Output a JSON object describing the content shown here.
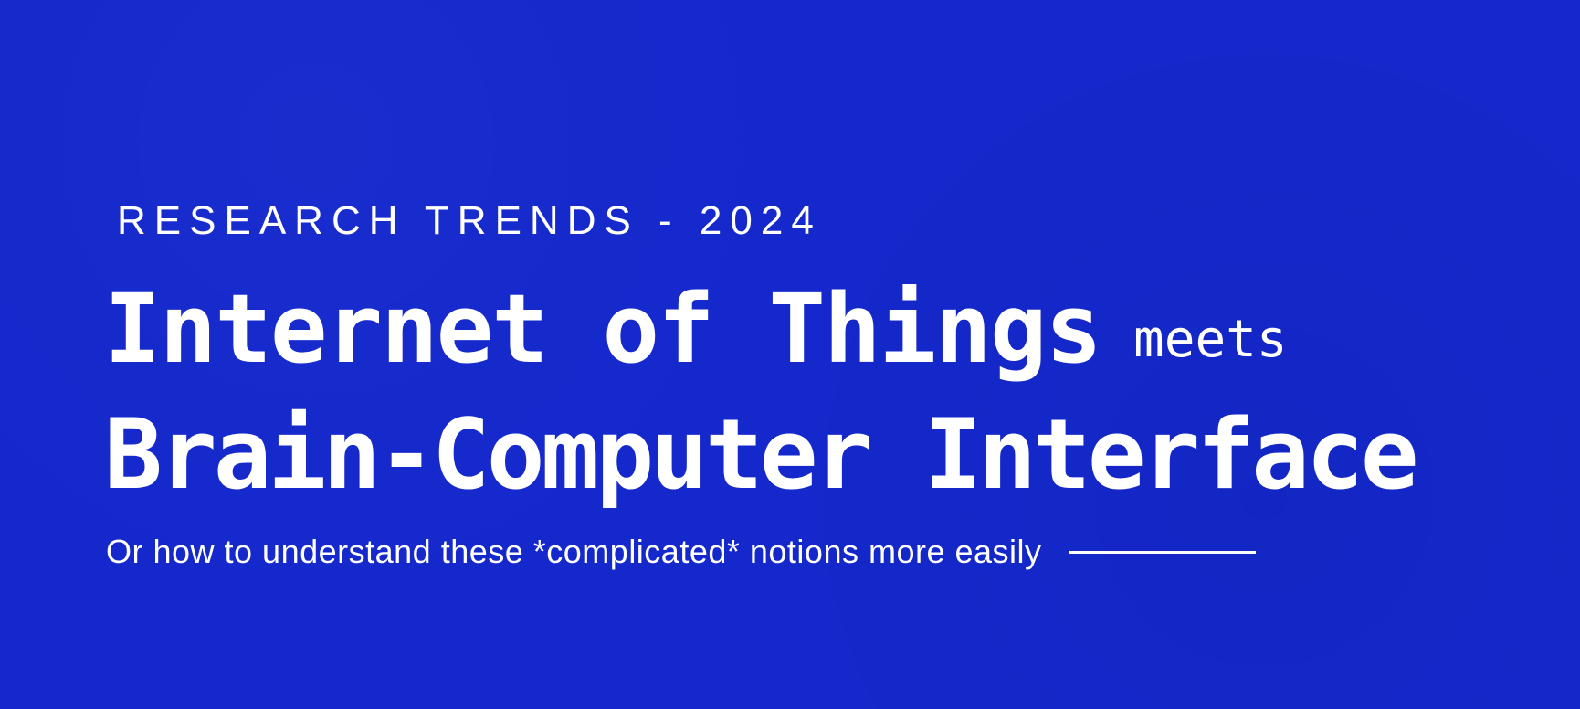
{
  "hero": {
    "eyebrow": "RESEARCH TRENDS - 2024",
    "headline_line1": "Internet of Things",
    "headline_connector": "meets",
    "headline_line2": "Brain-Computer Interface",
    "subtitle": "Or how to understand these *complicated* notions more easily"
  },
  "colors": {
    "background": "#1428CC",
    "text": "#FFFFFF"
  }
}
